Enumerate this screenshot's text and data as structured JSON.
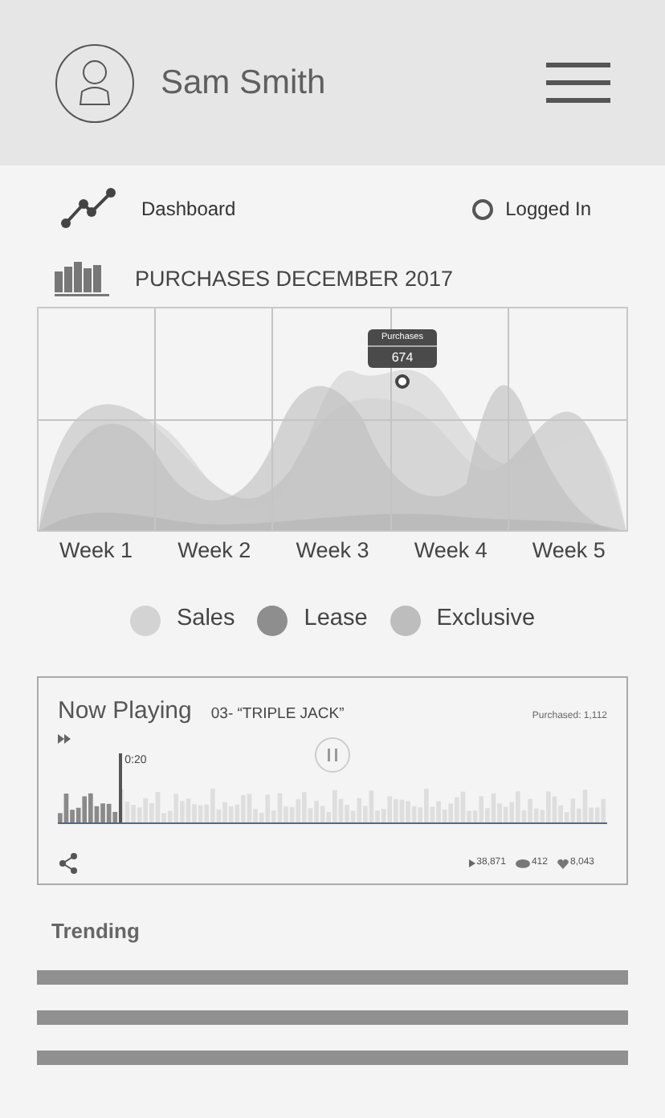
{
  "header": {
    "user_name": "Sam Smith"
  },
  "nav": {
    "dashboard_label": "Dashboard",
    "status_label": "Logged In"
  },
  "purchases": {
    "title": "PURCHASES DECEMBER 2017",
    "tooltip": {
      "label": "Purchases",
      "value": "674"
    },
    "x_labels": [
      "Week 1",
      "Week 2",
      "Week 3",
      "Week 4",
      "Week 5"
    ],
    "legend": [
      {
        "label": "Sales",
        "color": "#d3d3d3"
      },
      {
        "label": "Lease",
        "color": "#8e8e8e"
      },
      {
        "label": "Exclusive",
        "color": "#bdbdbd"
      }
    ]
  },
  "now_playing": {
    "title": "Now Playing",
    "track": "03- “TRIPLE JACK”",
    "purchased": "Purchased: 1,112",
    "time": "0:20",
    "level": 0.11,
    "plays": "38,871",
    "comments": "412",
    "likes": "8,043"
  },
  "trending": {
    "title": "Trending",
    "rows": [
      {
        "kind": "placeholder"
      },
      {
        "kind": "placeholder"
      },
      {
        "kind": "placeholder"
      }
    ]
  }
}
